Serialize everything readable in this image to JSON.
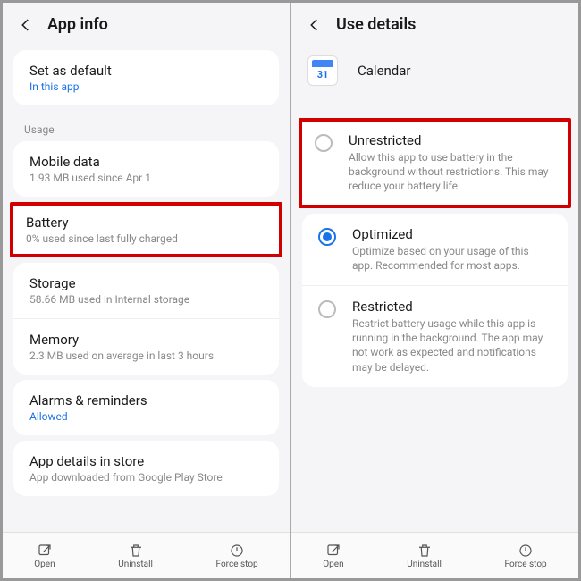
{
  "left": {
    "title": "App info",
    "default": {
      "title": "Set as default",
      "sub": "In this app"
    },
    "usage_label": "Usage",
    "mobile_data": {
      "title": "Mobile data",
      "sub": "1.93 MB used since Apr 1"
    },
    "battery": {
      "title": "Battery",
      "sub": "0% used since last fully charged"
    },
    "storage": {
      "title": "Storage",
      "sub": "58.66 MB used in Internal storage"
    },
    "memory": {
      "title": "Memory",
      "sub": "2.3 MB used on average in last 3 hours"
    },
    "alarms": {
      "title": "Alarms & reminders",
      "sub": "Allowed"
    },
    "store": {
      "title": "App details in store",
      "sub": "App downloaded from Google Play Store"
    }
  },
  "right": {
    "title": "Use details",
    "app": {
      "name": "Calendar",
      "icon_day": "31"
    },
    "options": {
      "unrestricted": {
        "title": "Unrestricted",
        "desc": "Allow this app to use battery in the background without restrictions. This may reduce your battery life."
      },
      "optimized": {
        "title": "Optimized",
        "desc": "Optimize based on your usage of this app. Recommended for most apps."
      },
      "restricted": {
        "title": "Restricted",
        "desc": "Restrict battery usage while this app is running in the background. The app may not work as expected and notifications may be delayed."
      }
    }
  },
  "bottombar": {
    "open": "Open",
    "uninstall": "Uninstall",
    "force": "Force stop"
  }
}
